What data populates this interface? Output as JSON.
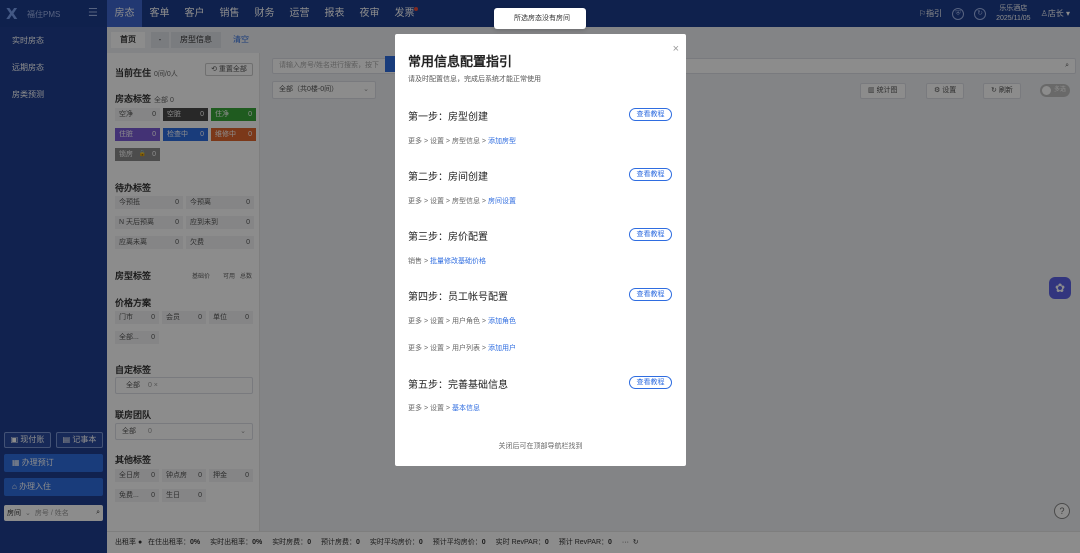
{
  "app": {
    "logo_text": "福住PMS"
  },
  "nav": [
    "房态",
    "客单",
    "客户",
    "销售",
    "财务",
    "运营",
    "报表",
    "夜审",
    "发票"
  ],
  "header": {
    "guide_label": "指引",
    "hotel_name": "乐乐酒店",
    "hotel_date": "2025/11/05",
    "user_role": "店长"
  },
  "sidebar": {
    "items": [
      "实时房态",
      "远期房态",
      "房类预测"
    ],
    "btn_cash": "现付账",
    "btn_notes": "记事本",
    "btn_booking": "办理预订",
    "btn_checkin": "办理入住",
    "search_type": "房间",
    "search_placeholder": "房号 / 姓名"
  },
  "subtabs": {
    "home": "首页",
    "dash": "-",
    "roomtype": "房型信息",
    "clear": "清空"
  },
  "left_panel": {
    "in_house_title": "当前在住",
    "in_house_value": "0间/0人",
    "reset_label": "重置全部",
    "room_tags_title": "房态标签",
    "room_tags_total": "全部 0",
    "status_tags": [
      {
        "label": "空净",
        "count": "0",
        "color": "#f2f3f5",
        "text": "#555"
      },
      {
        "label": "空脏",
        "count": "0",
        "color": "#4a4a4a",
        "text": "#fff"
      },
      {
        "label": "住净",
        "count": "0",
        "color": "#3aa63a",
        "text": "#fff"
      },
      {
        "label": "住脏",
        "count": "0",
        "color": "#7b5bd6",
        "text": "#fff"
      },
      {
        "label": "检查中",
        "count": "0",
        "color": "#2f6de0",
        "text": "#fff"
      },
      {
        "label": "维修中",
        "count": "0",
        "color": "#e0662f",
        "text": "#fff"
      },
      {
        "label": "锁房",
        "count": "0",
        "color": "#8a8a8a",
        "text": "#fff"
      }
    ],
    "todo_title": "待办标签",
    "todo": [
      {
        "label": "今预抵",
        "count": "0"
      },
      {
        "label": "今预离",
        "count": "0"
      },
      {
        "label": "N 天后预离",
        "count": "0"
      },
      {
        "label": "应到未到",
        "count": "0"
      },
      {
        "label": "应离未离",
        "count": "0"
      },
      {
        "label": "欠费",
        "count": "0"
      }
    ],
    "roomtype_title": "房型标签",
    "roomtype_cols": [
      "基础价",
      "可用",
      "总数"
    ],
    "price_title": "价格方案",
    "price": [
      {
        "label": "门市",
        "count": "0"
      },
      {
        "label": "会员",
        "count": "0"
      },
      {
        "label": "单位",
        "count": "0"
      },
      {
        "label": "全部...",
        "count": "0"
      }
    ],
    "custom_title": "自定标签",
    "custom_value": "全部",
    "custom_count": "0 ×",
    "team_title": "联房团队",
    "team_value": "全部",
    "team_count": "0",
    "other_title": "其他标签",
    "other": [
      {
        "label": "全日房",
        "count": "0"
      },
      {
        "label": "钟点房",
        "count": "0"
      },
      {
        "label": "押金",
        "count": "0"
      },
      {
        "label": "免费...",
        "count": "0"
      },
      {
        "label": "生日",
        "count": "0"
      }
    ]
  },
  "main": {
    "search_placeholder": "请输入房号/姓名进行搜索，按下",
    "building_select": "全部（共0楼-0间）",
    "btn_stats": "统计图",
    "btn_settings": "设置",
    "btn_refresh": "刷新",
    "toggle_label": "多选"
  },
  "toast": "所选房态没有房间",
  "modal": {
    "title": "常用信息配置指引",
    "subtitle": "请及时配置信息，完成后系统才能正常使用",
    "tutorial_label": "查看教程",
    "footer": "关闭后可在顶部导航栏找到",
    "steps": [
      {
        "title": "第一步：房型创建",
        "path": "更多 > 设置 > 房型信息 >",
        "link": "添加房型"
      },
      {
        "title": "第二步：房间创建",
        "path": "更多 > 设置 > 房型信息 >",
        "link": "房间设置"
      },
      {
        "title": "第三步：房价配置",
        "path": "销售 >",
        "link": "批量修改基础价格"
      },
      {
        "title": "第四步：员工帐号配置",
        "path": "更多 > 设置 > 用户角色 >",
        "link": "添加角色",
        "path2": "更多 > 设置 > 用户列表 >",
        "link2": "添加用户"
      },
      {
        "title": "第五步：完善基础信息",
        "path": "更多 > 设置 >",
        "link": "基本信息"
      }
    ]
  },
  "statusbar": {
    "occ_label": "出租率",
    "occ_live_label": "在住出租率：",
    "occ_live": "0%",
    "occ_rt_label": "实时出租率：",
    "occ_rt": "0%",
    "fee_rt_label": "实时房费：",
    "fee_rt": "0",
    "fee_est_label": "预计房费：",
    "fee_est": "0",
    "avg_rt_label": "实时平均房价：",
    "avg_rt": "0",
    "avg_est_label": "预计平均房价：",
    "avg_est": "0",
    "revpar_rt_label": "实时 RevPAR：",
    "revpar_rt": "0",
    "revpar_est_label": "预计 RevPAR：",
    "revpar_est": "0",
    "more": "···"
  }
}
